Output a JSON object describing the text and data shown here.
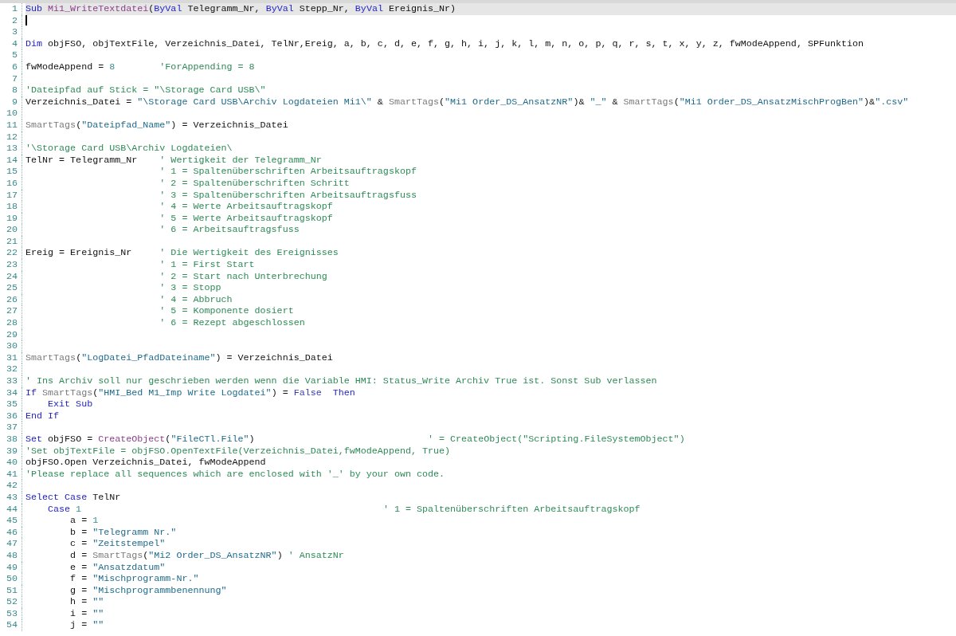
{
  "editor": {
    "lines": [
      {
        "number": "1",
        "highlighted": true,
        "cursor": false,
        "tokens": [
          {
            "kind": "kw",
            "text": "Sub"
          },
          {
            "kind": "fn",
            "text": " Mi1_WriteTextdatei"
          },
          {
            "kind": "plain",
            "text": "("
          },
          {
            "kind": "kw",
            "text": "ByVal"
          },
          {
            "kind": "plain",
            "text": " Telegramm_Nr, "
          },
          {
            "kind": "kw",
            "text": "ByVal"
          },
          {
            "kind": "plain",
            "text": " Stepp_Nr, "
          },
          {
            "kind": "kw",
            "text": "ByVal"
          },
          {
            "kind": "plain",
            "text": " Ereignis_Nr)"
          }
        ]
      },
      {
        "number": "2",
        "highlighted": false,
        "cursor": true
      },
      {
        "number": "3",
        "highlighted": false,
        "cursor": false
      },
      {
        "number": "4",
        "highlighted": false,
        "cursor": false,
        "tokens": [
          {
            "kind": "kw",
            "text": "Dim"
          },
          {
            "kind": "plain",
            "text": " objFSO, objTextFile, Verzeichnis_Datei, TelNr,Ereig, a, b, c, d, e, f, g, h, i, j, k, l, m, n, o, p, q, r, s, t, x, y, z, fwModeAppend, SPFunktion"
          }
        ]
      },
      {
        "number": "5",
        "highlighted": false,
        "cursor": false
      },
      {
        "number": "6",
        "highlighted": false,
        "cursor": false,
        "tokens": [
          {
            "kind": "plain",
            "text": "fwModeAppend = "
          },
          {
            "kind": "num",
            "text": "8"
          },
          {
            "kind": "cmt",
            "text": "        'ForAppending = 8"
          }
        ]
      },
      {
        "number": "7",
        "highlighted": false,
        "cursor": false
      },
      {
        "number": "8",
        "highlighted": false,
        "cursor": false,
        "tokens": [
          {
            "kind": "cmt",
            "text": "'Dateipfad auf Stick = \"\\Storage Card USB\\\""
          }
        ]
      },
      {
        "number": "9",
        "highlighted": false,
        "cursor": false,
        "tokens": [
          {
            "kind": "plain",
            "text": "Verzeichnis_Datei = "
          },
          {
            "kind": "str",
            "text": "\"\\Storage Card USB\\Archiv Logdateien Mi1\\\""
          },
          {
            "kind": "plain",
            "text": " & "
          },
          {
            "kind": "tag",
            "text": "SmartTags"
          },
          {
            "kind": "plain",
            "text": "("
          },
          {
            "kind": "str",
            "text": "\"Mi1 Order_DS_AnsatzNR\""
          },
          {
            "kind": "plain",
            "text": ")& "
          },
          {
            "kind": "str",
            "text": "\"_\""
          },
          {
            "kind": "plain",
            "text": " & "
          },
          {
            "kind": "tag",
            "text": "SmartTags"
          },
          {
            "kind": "plain",
            "text": "("
          },
          {
            "kind": "str",
            "text": "\"Mi1 Order_DS_AnsatzMischProgBen\""
          },
          {
            "kind": "plain",
            "text": ")&"
          },
          {
            "kind": "str",
            "text": "\".csv\""
          }
        ]
      },
      {
        "number": "10",
        "highlighted": false,
        "cursor": false
      },
      {
        "number": "11",
        "highlighted": false,
        "cursor": false,
        "tokens": [
          {
            "kind": "tag",
            "text": "SmartTags"
          },
          {
            "kind": "plain",
            "text": "("
          },
          {
            "kind": "str",
            "text": "\"Dateipfad_Name\""
          },
          {
            "kind": "plain",
            "text": ") = Verzeichnis_Datei"
          }
        ]
      },
      {
        "number": "12",
        "highlighted": false,
        "cursor": false
      },
      {
        "number": "13",
        "highlighted": false,
        "cursor": false,
        "tokens": [
          {
            "kind": "cmt",
            "text": "'\\Storage Card USB\\Archiv Logdateien\\"
          }
        ]
      },
      {
        "number": "14",
        "highlighted": false,
        "cursor": false,
        "tokens": [
          {
            "kind": "plain",
            "text": "TelNr = Telegramm_Nr"
          },
          {
            "kind": "cmt",
            "text": "    ' Wertigkeit der Telegramm_Nr"
          }
        ]
      },
      {
        "number": "15",
        "highlighted": false,
        "cursor": false,
        "tokens": [
          {
            "kind": "cmt",
            "text": "                        ' 1 = Spaltenüberschriften Arbeitsauftragskopf"
          }
        ]
      },
      {
        "number": "16",
        "highlighted": false,
        "cursor": false,
        "tokens": [
          {
            "kind": "cmt",
            "text": "                        ' 2 = Spaltenüberschriften Schritt"
          }
        ]
      },
      {
        "number": "17",
        "highlighted": false,
        "cursor": false,
        "tokens": [
          {
            "kind": "cmt",
            "text": "                        ' 3 = Spaltenüberschriften Arbeitsauftragsfuss"
          }
        ]
      },
      {
        "number": "18",
        "highlighted": false,
        "cursor": false,
        "tokens": [
          {
            "kind": "cmt",
            "text": "                        ' 4 = Werte Arbeitsauftragskopf"
          }
        ]
      },
      {
        "number": "19",
        "highlighted": false,
        "cursor": false,
        "tokens": [
          {
            "kind": "cmt",
            "text": "                        ' 5 = Werte Arbeitsauftragskopf"
          }
        ]
      },
      {
        "number": "20",
        "highlighted": false,
        "cursor": false,
        "tokens": [
          {
            "kind": "cmt",
            "text": "                        ' 6 = Arbeitsauftragsfuss"
          }
        ]
      },
      {
        "number": "21",
        "highlighted": false,
        "cursor": false
      },
      {
        "number": "22",
        "highlighted": false,
        "cursor": false,
        "tokens": [
          {
            "kind": "plain",
            "text": "Ereig = Ereignis_Nr"
          },
          {
            "kind": "cmt",
            "text": "     ' Die Wertigkeit des Ereignisses"
          }
        ]
      },
      {
        "number": "23",
        "highlighted": false,
        "cursor": false,
        "tokens": [
          {
            "kind": "cmt",
            "text": "                        ' 1 = First Start"
          }
        ]
      },
      {
        "number": "24",
        "highlighted": false,
        "cursor": false,
        "tokens": [
          {
            "kind": "cmt",
            "text": "                        ' 2 = Start nach Unterbrechung"
          }
        ]
      },
      {
        "number": "25",
        "highlighted": false,
        "cursor": false,
        "tokens": [
          {
            "kind": "cmt",
            "text": "                        ' 3 = Stopp"
          }
        ]
      },
      {
        "number": "26",
        "highlighted": false,
        "cursor": false,
        "tokens": [
          {
            "kind": "cmt",
            "text": "                        ' 4 = Abbruch"
          }
        ]
      },
      {
        "number": "27",
        "highlighted": false,
        "cursor": false,
        "tokens": [
          {
            "kind": "cmt",
            "text": "                        ' 5 = Komponente dosiert"
          }
        ]
      },
      {
        "number": "28",
        "highlighted": false,
        "cursor": false,
        "tokens": [
          {
            "kind": "cmt",
            "text": "                        ' 6 = Rezept abgeschlossen"
          }
        ]
      },
      {
        "number": "29",
        "highlighted": false,
        "cursor": false
      },
      {
        "number": "30",
        "highlighted": false,
        "cursor": false
      },
      {
        "number": "31",
        "highlighted": false,
        "cursor": false,
        "tokens": [
          {
            "kind": "tag",
            "text": "SmartTags"
          },
          {
            "kind": "plain",
            "text": "("
          },
          {
            "kind": "str",
            "text": "\"LogDatei_PfadDateiname\""
          },
          {
            "kind": "plain",
            "text": ") = Verzeichnis_Datei"
          }
        ]
      },
      {
        "number": "32",
        "highlighted": false,
        "cursor": false
      },
      {
        "number": "33",
        "highlighted": false,
        "cursor": false,
        "tokens": [
          {
            "kind": "cmt",
            "text": "' Ins Archiv soll nur geschrieben werden wenn die Variable HMI: Status_Write Archiv True ist. Sonst Sub verlassen"
          }
        ]
      },
      {
        "number": "34",
        "highlighted": false,
        "cursor": false,
        "tokens": [
          {
            "kind": "kw",
            "text": "If"
          },
          {
            "kind": "tag",
            "text": " SmartTags"
          },
          {
            "kind": "plain",
            "text": "("
          },
          {
            "kind": "str",
            "text": "\"HMI_Bed M1_Imp Write Logdatei\""
          },
          {
            "kind": "plain",
            "text": ") = "
          },
          {
            "kind": "kw2",
            "text": "False"
          },
          {
            "kind": "kw",
            "text": "  Then"
          }
        ]
      },
      {
        "number": "35",
        "highlighted": false,
        "cursor": false,
        "tokens": [
          {
            "kind": "kw",
            "text": "    Exit Sub"
          }
        ]
      },
      {
        "number": "36",
        "highlighted": false,
        "cursor": false,
        "tokens": [
          {
            "kind": "kw",
            "text": "End If"
          }
        ]
      },
      {
        "number": "37",
        "highlighted": false,
        "cursor": false
      },
      {
        "number": "38",
        "highlighted": false,
        "cursor": false,
        "tokens": [
          {
            "kind": "kw",
            "text": "Set"
          },
          {
            "kind": "plain",
            "text": " objFSO = "
          },
          {
            "kind": "fn",
            "text": "CreateObject"
          },
          {
            "kind": "plain",
            "text": "("
          },
          {
            "kind": "str",
            "text": "\"FileCTl.File\""
          },
          {
            "kind": "plain",
            "text": ")"
          },
          {
            "kind": "cmt",
            "text": "                               ' = CreateObject(\"Scripting.FileSystemObject\")"
          }
        ]
      },
      {
        "number": "39",
        "highlighted": false,
        "cursor": false,
        "tokens": [
          {
            "kind": "cmt",
            "text": "'Set objTextFile = objFSO.OpenTextFile(Verzeichnis_Datei,fwModeAppend, True)"
          }
        ]
      },
      {
        "number": "40",
        "highlighted": false,
        "cursor": false,
        "tokens": [
          {
            "kind": "plain",
            "text": "objFSO.Open Verzeichnis_Datei, fwModeAppend"
          }
        ]
      },
      {
        "number": "41",
        "highlighted": false,
        "cursor": false,
        "tokens": [
          {
            "kind": "cmt",
            "text": "'Please replace all sequences which are enclosed with '_' by your own code."
          }
        ]
      },
      {
        "number": "42",
        "highlighted": false,
        "cursor": false
      },
      {
        "number": "43",
        "highlighted": false,
        "cursor": false,
        "tokens": [
          {
            "kind": "kw",
            "text": "Select Case"
          },
          {
            "kind": "plain",
            "text": " TelNr"
          }
        ]
      },
      {
        "number": "44",
        "highlighted": false,
        "cursor": false,
        "tokens": [
          {
            "kind": "kw",
            "text": "    Case"
          },
          {
            "kind": "num",
            "text": " 1"
          },
          {
            "kind": "cmt",
            "text": "                                                      ' 1 = Spaltenüberschriften Arbeitsauftragskopf"
          }
        ]
      },
      {
        "number": "45",
        "highlighted": false,
        "cursor": false,
        "tokens": [
          {
            "kind": "plain",
            "text": "        a = "
          },
          {
            "kind": "num",
            "text": "1"
          }
        ]
      },
      {
        "number": "46",
        "highlighted": false,
        "cursor": false,
        "tokens": [
          {
            "kind": "plain",
            "text": "        b = "
          },
          {
            "kind": "str",
            "text": "\"Telegramm Nr.\""
          }
        ]
      },
      {
        "number": "47",
        "highlighted": false,
        "cursor": false,
        "tokens": [
          {
            "kind": "plain",
            "text": "        c = "
          },
          {
            "kind": "str",
            "text": "\"Zeitstempel\""
          }
        ]
      },
      {
        "number": "48",
        "highlighted": false,
        "cursor": false,
        "tokens": [
          {
            "kind": "plain",
            "text": "        d = "
          },
          {
            "kind": "tag",
            "text": "SmartTags"
          },
          {
            "kind": "plain",
            "text": "("
          },
          {
            "kind": "str",
            "text": "\"Mi2 Order_DS_AnsatzNR\""
          },
          {
            "kind": "plain",
            "text": ")"
          },
          {
            "kind": "cmt",
            "text": " ' AnsatzNr"
          }
        ]
      },
      {
        "number": "49",
        "highlighted": false,
        "cursor": false,
        "tokens": [
          {
            "kind": "plain",
            "text": "        e = "
          },
          {
            "kind": "str",
            "text": "\"Ansatzdatum\""
          }
        ]
      },
      {
        "number": "50",
        "highlighted": false,
        "cursor": false,
        "tokens": [
          {
            "kind": "plain",
            "text": "        f = "
          },
          {
            "kind": "str",
            "text": "\"Mischprogramm-Nr.\""
          }
        ]
      },
      {
        "number": "51",
        "highlighted": false,
        "cursor": false,
        "tokens": [
          {
            "kind": "plain",
            "text": "        g = "
          },
          {
            "kind": "str",
            "text": "\"Mischprogrammbenennung\""
          }
        ]
      },
      {
        "number": "52",
        "highlighted": false,
        "cursor": false,
        "tokens": [
          {
            "kind": "plain",
            "text": "        h = "
          },
          {
            "kind": "str",
            "text": "\"\""
          }
        ]
      },
      {
        "number": "53",
        "highlighted": false,
        "cursor": false,
        "tokens": [
          {
            "kind": "plain",
            "text": "        i = "
          },
          {
            "kind": "str",
            "text": "\"\""
          }
        ]
      },
      {
        "number": "54",
        "highlighted": false,
        "cursor": false,
        "tokens": [
          {
            "kind": "plain",
            "text": "        j = "
          },
          {
            "kind": "str",
            "text": "\"\""
          }
        ]
      }
    ]
  }
}
